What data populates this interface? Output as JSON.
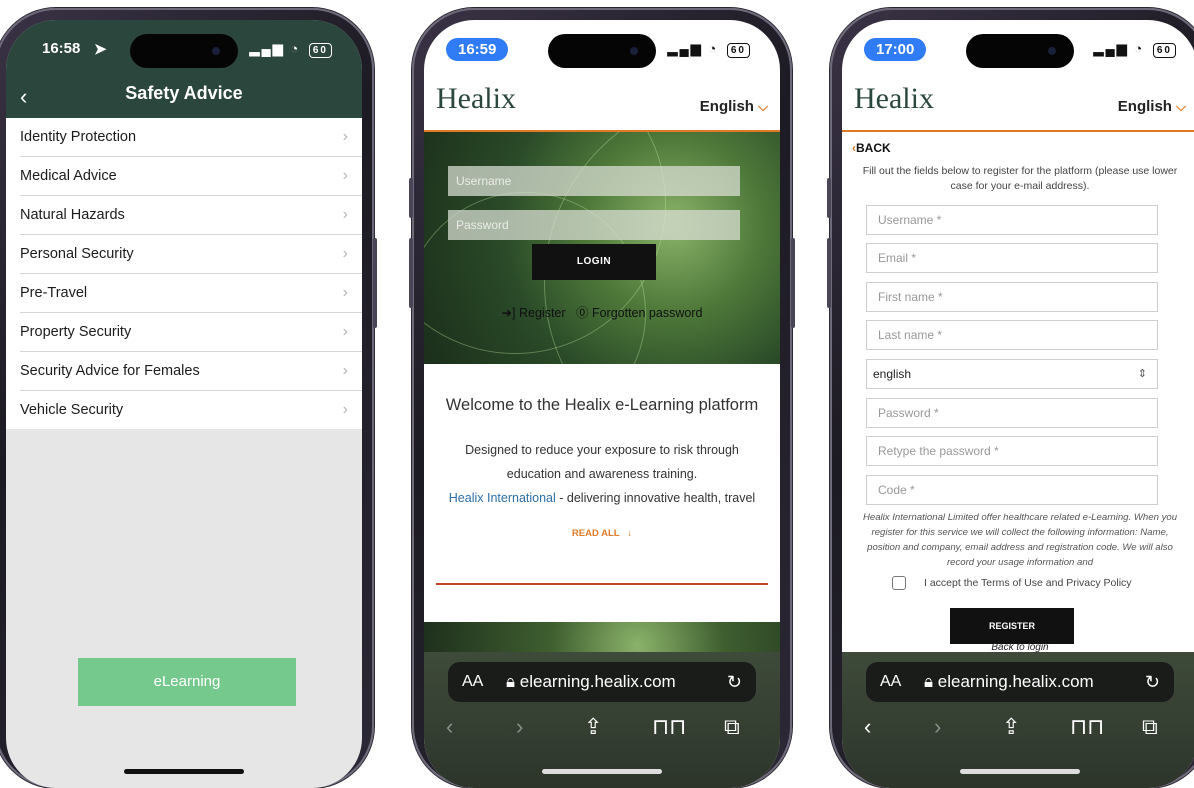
{
  "phone1": {
    "status_time": "16:58",
    "battery": "60",
    "nav_title": "Safety Advice",
    "items": [
      {
        "label": "Identity Protection"
      },
      {
        "label": "Medical Advice"
      },
      {
        "label": "Natural Hazards"
      },
      {
        "label": "Personal Security"
      },
      {
        "label": "Pre-Travel"
      },
      {
        "label": "Property Security"
      },
      {
        "label": "Security Advice for Females"
      },
      {
        "label": "Vehicle Security"
      }
    ],
    "elearning_button": "eLearning"
  },
  "phone2": {
    "status_time": "16:59",
    "battery": "60",
    "logo": "Healix",
    "language": "English",
    "username_placeholder": "Username",
    "password_placeholder": "Password",
    "login_button": "LOGIN",
    "register_link": "Register",
    "forgot_link": "Forgotten password",
    "welcome": "Welcome to the Healix e-Learning platform",
    "desc_line1": "Designed to reduce your exposure to risk through",
    "desc_line2": "education and awareness training.",
    "desc_link": "Healix International",
    "desc_line3": " - delivering innovative health, travel",
    "read_all": "READ ALL",
    "url": "elearning.healix.com",
    "aa": "AA"
  },
  "phone3": {
    "status_time": "17:00",
    "battery": "60",
    "logo": "Healix",
    "language": "English",
    "back": "BACK",
    "intro": "Fill out the fields below to register for the platform (please use lower case for your e-mail address).",
    "fields": {
      "username": "Username *",
      "email": "Email *",
      "first_name": "First name *",
      "last_name": "Last name *",
      "language_value": "english",
      "password": "Password *",
      "retype": "Retype the password *",
      "code": "Code *"
    },
    "privacy": "Healix International Limited offer healthcare related e-Learning. When you register for this service we will collect the following information: Name, position and company, email address and registration code. We will also record your usage information and",
    "terms": "I accept the Terms of Use and Privacy Policy",
    "register_button": "REGISTER",
    "back_to_login": "Back to login",
    "url": "elearning.healix.com",
    "aa": "AA"
  }
}
